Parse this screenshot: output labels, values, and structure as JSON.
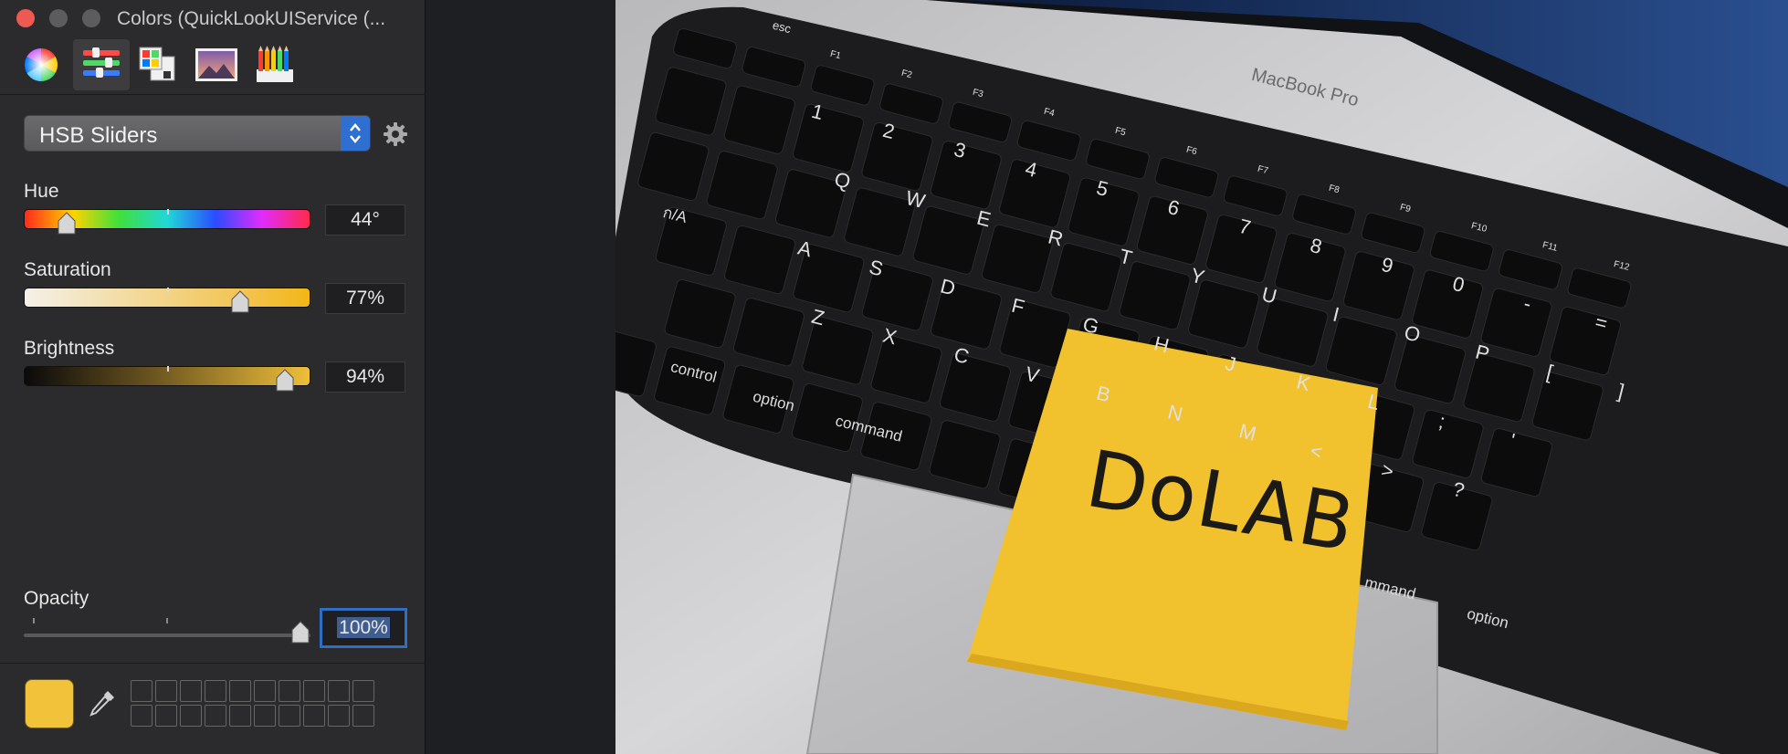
{
  "window": {
    "title": "Colors (QuickLookUIService (..."
  },
  "toolbar": {
    "tabs": [
      {
        "icon": "color-wheel-icon",
        "label": "Color Wheel"
      },
      {
        "icon": "sliders-icon",
        "label": "Color Sliders",
        "active": true
      },
      {
        "icon": "palettes-icon",
        "label": "Color Palettes"
      },
      {
        "icon": "image-palettes-icon",
        "label": "Image Palettes"
      },
      {
        "icon": "pencils-icon",
        "label": "Pencils"
      }
    ]
  },
  "mode_select": {
    "value": "HSB Sliders"
  },
  "sliders": {
    "hue": {
      "label": "Hue",
      "value": "44°",
      "fraction": 0.12
    },
    "saturation": {
      "label": "Saturation",
      "value": "77%",
      "fraction": 0.77
    },
    "brightness": {
      "label": "Brightness",
      "value": "94%",
      "fraction": 0.94
    }
  },
  "opacity": {
    "label": "Opacity",
    "value": "100%",
    "fraction": 1.0
  },
  "current_color": "#f1c23a",
  "swatch_wells": {
    "count": 20
  },
  "photo": {
    "note_text": "DoLAB",
    "laptop_brand": "MacBook Pro",
    "keys": {
      "esc": "esc",
      "control": "control",
      "option_left": "option",
      "command_left": "command",
      "option_right": "option",
      "command_right_partial": "mmand",
      "thai_tab": "ก/A",
      "fkeys": [
        "F1",
        "F2",
        "F3",
        "F4",
        "F5",
        "F6",
        "F7",
        "F8",
        "F9",
        "F10",
        "F11",
        "F12"
      ],
      "row1": [
        "1",
        "2",
        "3",
        "4",
        "5",
        "6",
        "7",
        "8",
        "9",
        "0",
        "-",
        "="
      ],
      "row2": [
        "Q",
        "W",
        "E",
        "R",
        "T",
        "Y",
        "U",
        "I",
        "O",
        "P",
        "[",
        "]"
      ],
      "row3": [
        "A",
        "S",
        "D",
        "F",
        "G",
        "H",
        "J",
        "K",
        "L",
        ";",
        "'"
      ],
      "row4": [
        "Z",
        "X",
        "C",
        "V",
        "B",
        "N",
        "M",
        "<",
        ">",
        "?"
      ]
    }
  }
}
